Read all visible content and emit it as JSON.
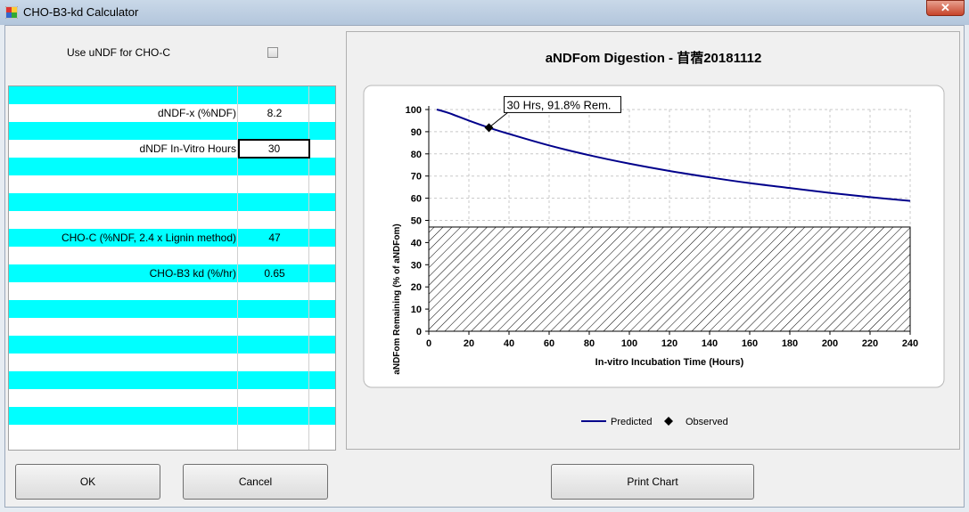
{
  "window": {
    "title": "CHO-B3-kd Calculator",
    "close_glyph": "✕"
  },
  "options": {
    "use_undf_label": "Use uNDF for CHO-C",
    "use_undf_checked": false
  },
  "grid": {
    "rows": [
      {
        "label": "dNDF-x (%NDF)",
        "value": "8.2"
      },
      {
        "label": "dNDF In-Vitro Hours",
        "value": "30"
      },
      {
        "label": "CHO-C (%NDF, 2.4 x Lignin method)",
        "value": "47"
      },
      {
        "label": "CHO-B3 kd (%/hr)",
        "value": "0.65"
      }
    ]
  },
  "chart_data": {
    "type": "line",
    "title": "aNDFom Digestion - 苜蓿20181112",
    "xlabel": "In-vitro Incubation Time (Hours)",
    "ylabel": "aNDFom Remaining (% of aNDFom)",
    "xlim": [
      0,
      240
    ],
    "ylim": [
      0,
      100
    ],
    "xticks": [
      0,
      20,
      40,
      60,
      80,
      100,
      120,
      140,
      160,
      180,
      200,
      220,
      240
    ],
    "yticks": [
      0,
      10,
      20,
      30,
      40,
      50,
      60,
      70,
      80,
      90,
      100
    ],
    "grid": true,
    "legend_position": "bottom",
    "series": [
      {
        "name": "Predicted",
        "color": "#00008b",
        "x": [
          4,
          10,
          20,
          30,
          40,
          60,
          80,
          100,
          120,
          140,
          160,
          180,
          200,
          220,
          240
        ],
        "y": [
          100,
          98.4,
          95.0,
          91.8,
          89.0,
          83.8,
          79.4,
          75.6,
          72.3,
          69.4,
          66.8,
          64.6,
          62.4,
          60.5,
          58.8
        ]
      },
      {
        "name": "Observed",
        "marker": "diamond",
        "x": [
          30
        ],
        "y": [
          91.8
        ]
      }
    ],
    "annotation": {
      "text": "30 Hrs, 91.8% Rem.",
      "x": 30,
      "y": 91.8
    },
    "hatched_region": {
      "from": 0,
      "to": 47,
      "xmin": 0,
      "xmax": 240
    }
  },
  "buttons": {
    "ok": "OK",
    "cancel": "Cancel",
    "print": "Print Chart"
  }
}
